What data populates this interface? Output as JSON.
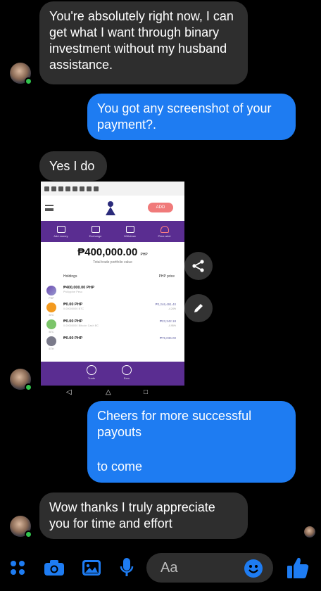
{
  "messages": {
    "m1": "You're absolutely right now, I can get what I want through binary investment without my husband assistance.",
    "m2": "You got any screenshot of your payment?.",
    "m3": "Yes I do",
    "m4_line1": "Cheers for more successful payouts",
    "m4_line2": "to come",
    "m5": "Wow thanks I truly appreciate you for time and effort"
  },
  "shared_screenshot": {
    "add_button": "ADD",
    "quick_actions": [
      "Add money",
      "Exchange",
      "Withdraw",
      "Price alert"
    ],
    "balance": "400,000.00",
    "balance_unit": "PHP",
    "balance_sub": "Total trade portfolio value",
    "holdings_label": "Holdings",
    "price_label": "PHP price",
    "holdings": [
      {
        "symbol": "PHP",
        "amount": "₱400,000.00 PHP",
        "sub": "Philippine Peso",
        "price": "",
        "change": ""
      },
      {
        "symbol": "BTC",
        "amount": "₱0.00 PHP",
        "sub": "0.00000000 BTC",
        "price": "₱2,246,491.40",
        "change": "-4.24%"
      },
      {
        "symbol": "BTC",
        "amount": "₱0.00 PHP",
        "sub": "0.00000000 Bitcoin Cash BC",
        "price": "₱23,342.18",
        "change": "-0.95%"
      },
      {
        "symbol": "ETH",
        "amount": "₱0.00 PHP",
        "sub": "",
        "price": "₱75,036.00",
        "change": ""
      }
    ],
    "bottom_tabs": [
      "Trade",
      "Earn"
    ]
  },
  "composer": {
    "placeholder": "Aa"
  },
  "colors": {
    "incoming_bubble": "#2e2e2e",
    "outgoing_bubble": "#1e7cf2",
    "accent": "#1877f2",
    "app_purple": "#5a2d91"
  }
}
